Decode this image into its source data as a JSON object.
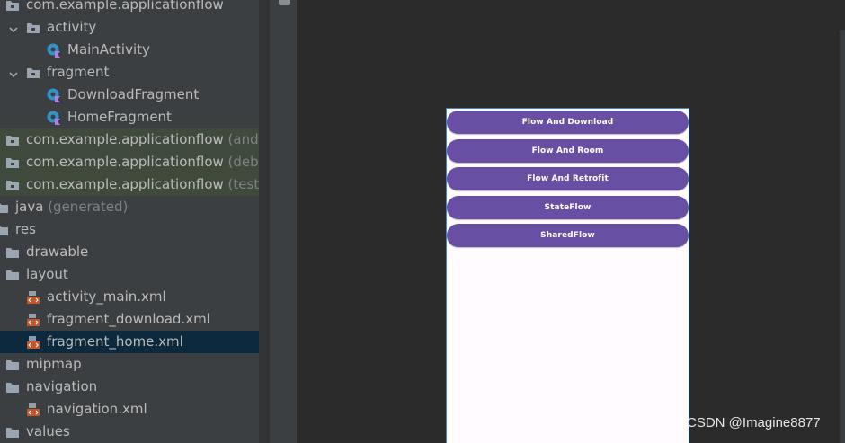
{
  "project_tree": {
    "items": [
      {
        "label": "com.example.applicationflow",
        "suffix": "",
        "level": 0,
        "icon": "package-folder-icon",
        "arrow": "",
        "style": ""
      },
      {
        "label": "activity",
        "suffix": "",
        "level": 1,
        "icon": "package-folder-icon",
        "arrow": "chevron-down-icon",
        "style": ""
      },
      {
        "label": "MainActivity",
        "suffix": "",
        "level": 2,
        "icon": "kotlin-class-icon",
        "arrow": "",
        "style": ""
      },
      {
        "label": "fragment",
        "suffix": "",
        "level": 1,
        "icon": "package-folder-icon",
        "arrow": "chevron-down-icon",
        "style": ""
      },
      {
        "label": "DownloadFragment",
        "suffix": "",
        "level": 2,
        "icon": "kotlin-class-icon",
        "arrow": "",
        "style": ""
      },
      {
        "label": "HomeFragment",
        "suffix": "",
        "level": 2,
        "icon": "kotlin-class-icon",
        "arrow": "",
        "style": ""
      },
      {
        "label": "com.example.applicationflow",
        "suffix": "(androi",
        "level": 0,
        "icon": "package-folder-icon",
        "arrow": "",
        "style": "mod"
      },
      {
        "label": "com.example.applicationflow",
        "suffix": "(debug",
        "level": 0,
        "icon": "package-folder-icon",
        "arrow": "",
        "style": "mod"
      },
      {
        "label": "com.example.applicationflow",
        "suffix": "(test)",
        "level": 0,
        "icon": "package-folder-icon",
        "arrow": "",
        "style": "mod"
      },
      {
        "label": "java",
        "suffix": "(generated)",
        "level": -1,
        "icon": "folder-icon",
        "arrow": "",
        "style": ""
      },
      {
        "label": "res",
        "suffix": "",
        "level": -1,
        "icon": "folder-icon",
        "arrow": "",
        "style": ""
      },
      {
        "label": "drawable",
        "suffix": "",
        "level": 0,
        "icon": "folder-icon",
        "arrow": "",
        "style": ""
      },
      {
        "label": "layout",
        "suffix": "",
        "level": 0,
        "icon": "folder-icon",
        "arrow": "",
        "style": ""
      },
      {
        "label": "activity_main.xml",
        "suffix": "",
        "level": 1,
        "icon": "layout-xml-icon",
        "arrow": "",
        "style": ""
      },
      {
        "label": "fragment_download.xml",
        "suffix": "",
        "level": 1,
        "icon": "layout-xml-icon",
        "arrow": "",
        "style": ""
      },
      {
        "label": "fragment_home.xml",
        "suffix": "",
        "level": 1,
        "icon": "layout-xml-icon",
        "arrow": "",
        "style": "sel"
      },
      {
        "label": "mipmap",
        "suffix": "",
        "level": 0,
        "icon": "folder-icon",
        "arrow": "",
        "style": ""
      },
      {
        "label": "navigation",
        "suffix": "",
        "level": 0,
        "icon": "folder-icon",
        "arrow": "",
        "style": ""
      },
      {
        "label": "navigation.xml",
        "suffix": "",
        "level": 1,
        "icon": "layout-xml-icon",
        "arrow": "",
        "style": ""
      },
      {
        "label": "values",
        "suffix": "",
        "level": 0,
        "icon": "folder-icon",
        "arrow": "",
        "style": ""
      }
    ]
  },
  "preview": {
    "buttons": [
      {
        "label": "Flow And Download"
      },
      {
        "label": "Flow And Room"
      },
      {
        "label": "Flow And Retrofit"
      },
      {
        "label": "StateFlow"
      },
      {
        "label": "SharedFlow"
      }
    ]
  },
  "watermark": "CSDN @Imagine8877",
  "colors": {
    "tree_bg": "#3c3f41",
    "selection": "#0d293e",
    "module_highlight": "#3f4a3d",
    "editor_bg": "#2b2b2b",
    "button_purple": "#6750a4",
    "phone_bg": "#fffbfe",
    "phone_border": "#3d86d6"
  }
}
